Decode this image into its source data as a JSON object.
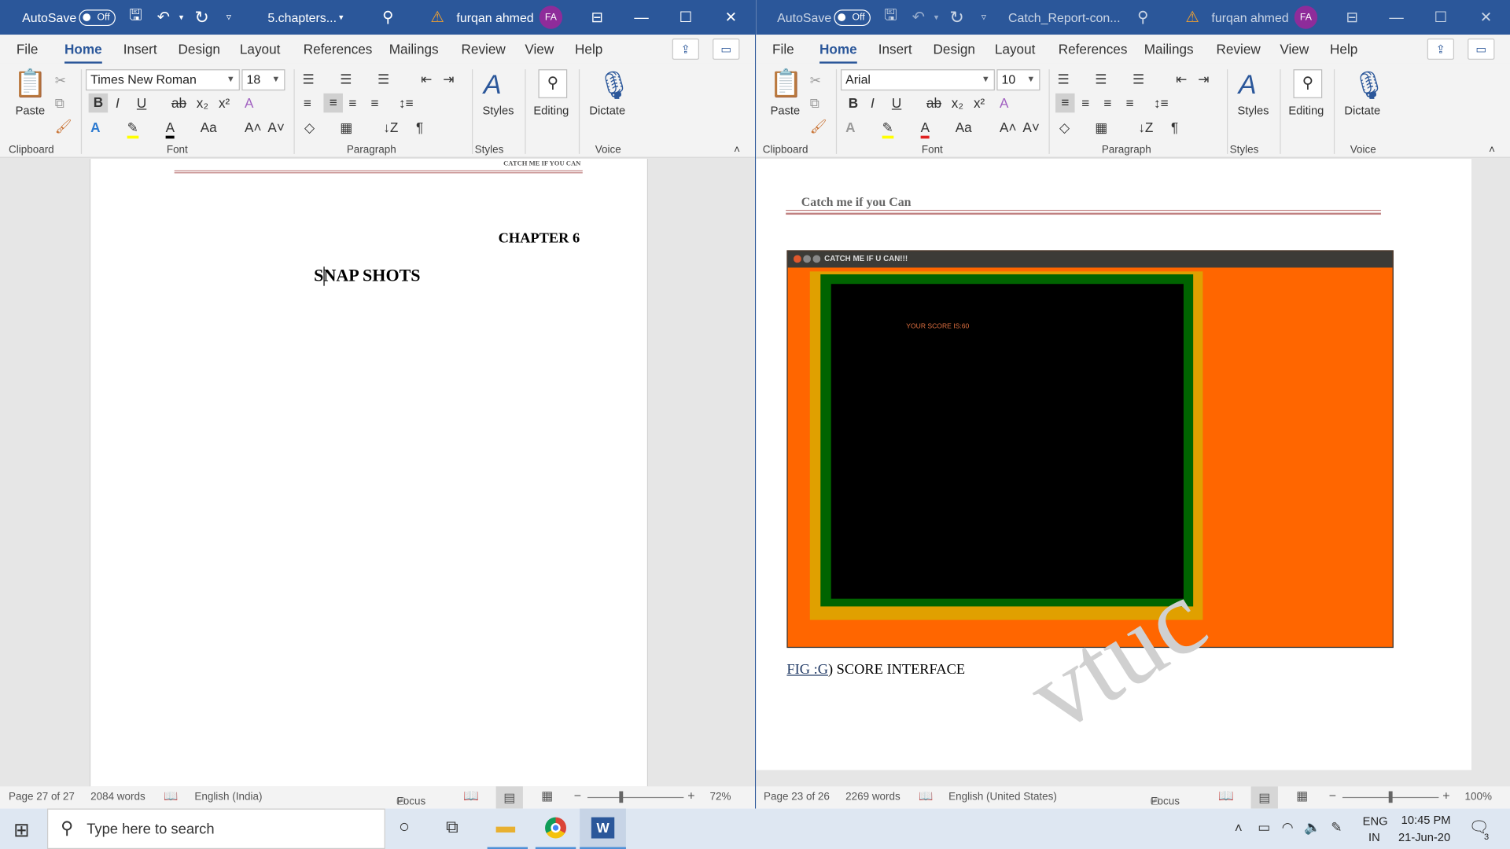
{
  "left": {
    "title": {
      "autosave": "AutoSave",
      "toggle": "Off",
      "doc": "5.chapters...",
      "user": "furqan ahmed",
      "initials": "FA"
    },
    "menu": [
      "File",
      "Home",
      "Insert",
      "Design",
      "Layout",
      "References",
      "Mailings",
      "Review",
      "View",
      "Help"
    ],
    "ribbon": {
      "paste": "Paste",
      "font_name": "Times New Roman",
      "font_size": "18",
      "styles": "Styles",
      "editing": "Editing",
      "dictate": "Dictate",
      "groups": {
        "clipboard": "Clipboard",
        "font": "Font",
        "paragraph": "Paragraph",
        "styles": "Styles",
        "voice": "Voice"
      }
    },
    "doc": {
      "header": "CATCH ME IF YOU CAN",
      "chapter": "CHAPTER 6",
      "heading": "SNAP SHOTS"
    },
    "status": {
      "page": "Page 27 of 27",
      "words": "2084 words",
      "lang": "English (India)",
      "focus": "Focus",
      "zoom": "72%"
    }
  },
  "right": {
    "title": {
      "autosave": "AutoSave",
      "toggle": "Off",
      "doc": "Catch_Report-con...",
      "user": "furqan ahmed",
      "initials": "FA"
    },
    "menu": [
      "File",
      "Home",
      "Insert",
      "Design",
      "Layout",
      "References",
      "Mailings",
      "Review",
      "View",
      "Help"
    ],
    "ribbon": {
      "paste": "Paste",
      "font_name": "Arial",
      "font_size": "10",
      "styles": "Styles",
      "editing": "Editing",
      "dictate": "Dictate",
      "groups": {
        "clipboard": "Clipboard",
        "font": "Font",
        "paragraph": "Paragraph",
        "styles": "Styles",
        "voice": "Voice"
      }
    },
    "doc": {
      "header": "Catch me if you Can",
      "game_title": "CATCH ME IF U CAN!!!",
      "score": "YOUR SCORE IS:60",
      "caption_ref": "FIG :G",
      "caption_rest": ") SCORE INTERFACE",
      "watermark": "vtuc"
    },
    "status": {
      "page": "Page 23 of 26",
      "words": "2269 words",
      "lang": "English (United States)",
      "focus": "Focus",
      "zoom": "100%"
    }
  },
  "taskbar": {
    "search_placeholder": "Type here to search",
    "lang1": "ENG",
    "lang2": "IN",
    "time": "10:45 PM",
    "date": "21-Jun-20",
    "notifications": "3"
  }
}
